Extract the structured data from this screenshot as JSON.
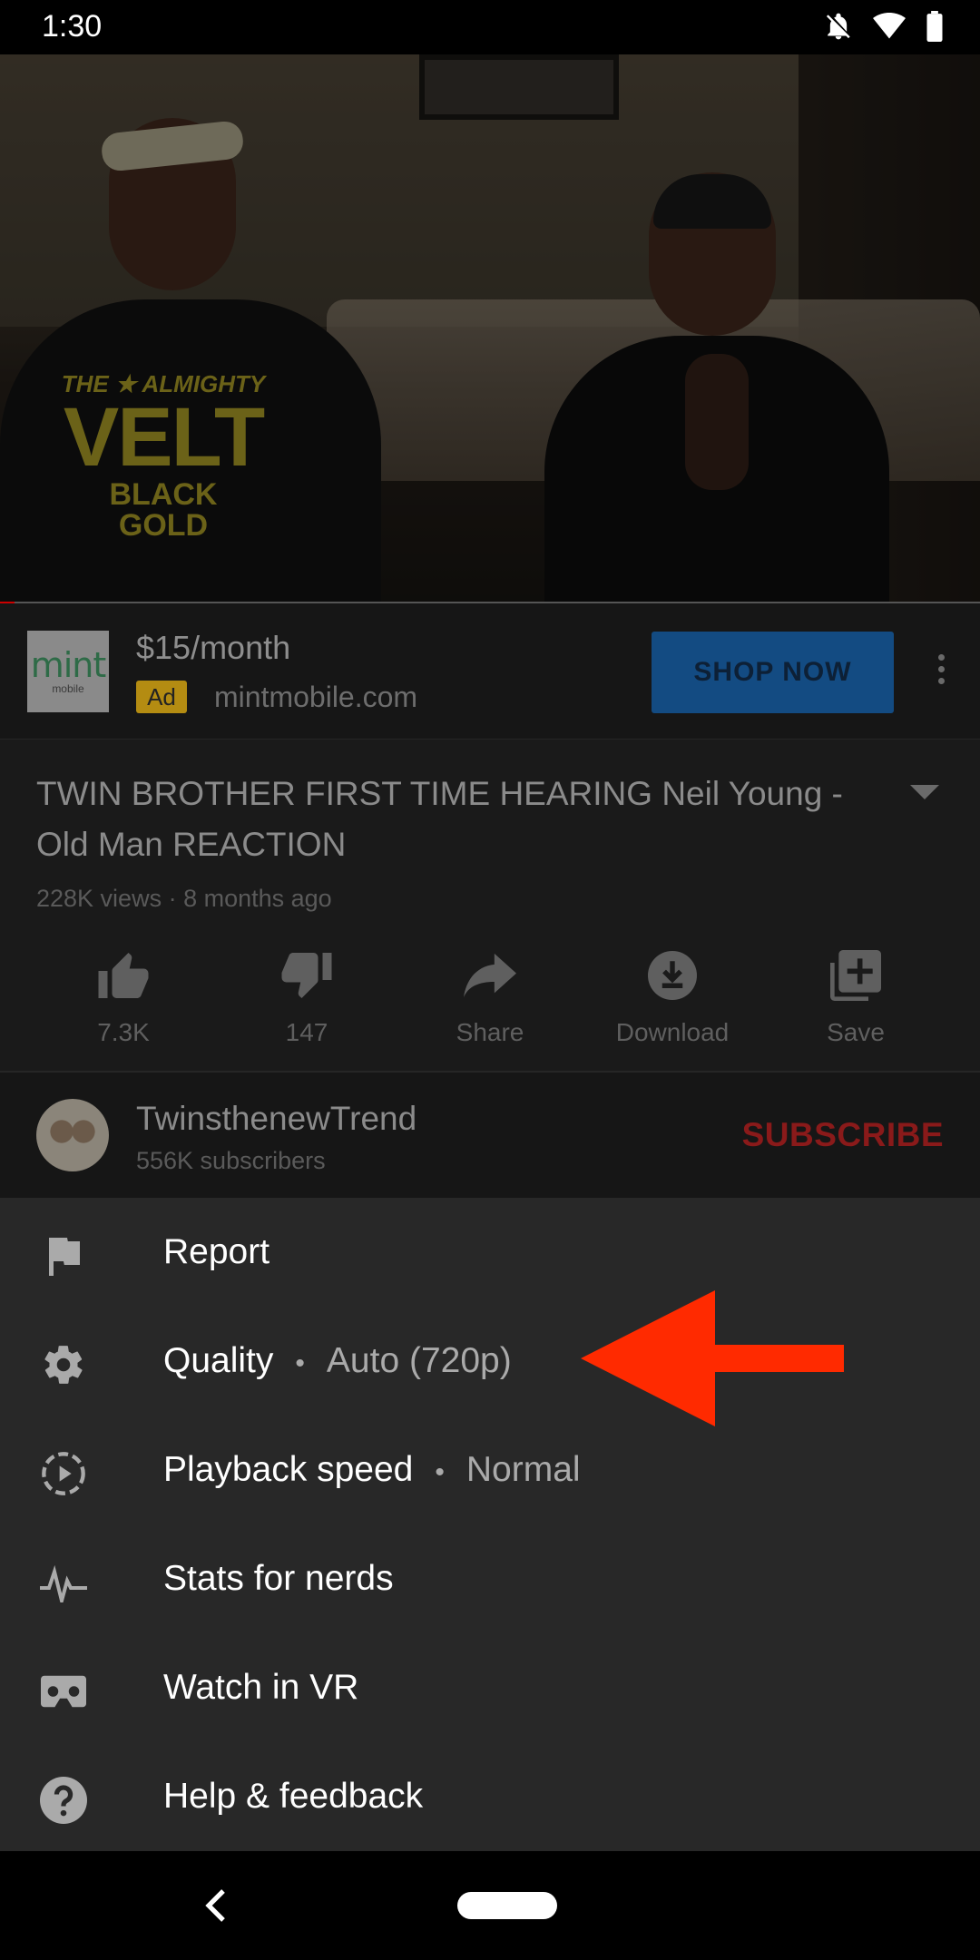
{
  "status_bar": {
    "time": "1:30",
    "icons": [
      "notifications-off-icon",
      "wifi-icon",
      "battery-icon"
    ]
  },
  "video": {
    "shirt_text": [
      "THE ★ ALMIGHTY",
      "VELT",
      "BLACK",
      "GOLD"
    ],
    "progress": 0.015
  },
  "ad": {
    "logo_text": "mint",
    "logo_subtext": "mobile",
    "price": "$15/month",
    "badge": "Ad",
    "domain": "mintmobile.com",
    "cta": "SHOP NOW"
  },
  "video_info": {
    "title": "TWIN BROTHER FIRST TIME HEARING Neil Young - Old Man REACTION",
    "meta": "228K views · 8 months ago"
  },
  "actions": [
    {
      "icon": "thumbs-up-icon",
      "label": "7.3K"
    },
    {
      "icon": "thumbs-down-icon",
      "label": "147"
    },
    {
      "icon": "share-icon",
      "label": "Share"
    },
    {
      "icon": "download-icon",
      "label": "Download"
    },
    {
      "icon": "save-playlist-icon",
      "label": "Save"
    }
  ],
  "channel": {
    "name": "TwinsthenewTrend",
    "subscribers": "556K subscribers",
    "subscribe_label": "SUBSCRIBE"
  },
  "menu": {
    "items": [
      {
        "icon": "flag-icon",
        "label": "Report"
      },
      {
        "icon": "gear-icon",
        "label": "Quality",
        "value": "Auto (720p)"
      },
      {
        "icon": "playback-speed-icon",
        "label": "Playback speed",
        "value": "Normal"
      },
      {
        "icon": "pulse-icon",
        "label": "Stats for nerds"
      },
      {
        "icon": "vr-headset-icon",
        "label": "Watch in VR"
      },
      {
        "icon": "help-icon",
        "label": "Help & feedback"
      }
    ],
    "separator": "•"
  },
  "annotation": {
    "arrow_color": "#ff2a00"
  },
  "colors": {
    "subscribe": "#8a1a1a",
    "shop_now_bg": "#134b82",
    "ad_badge": "#b48c12"
  }
}
